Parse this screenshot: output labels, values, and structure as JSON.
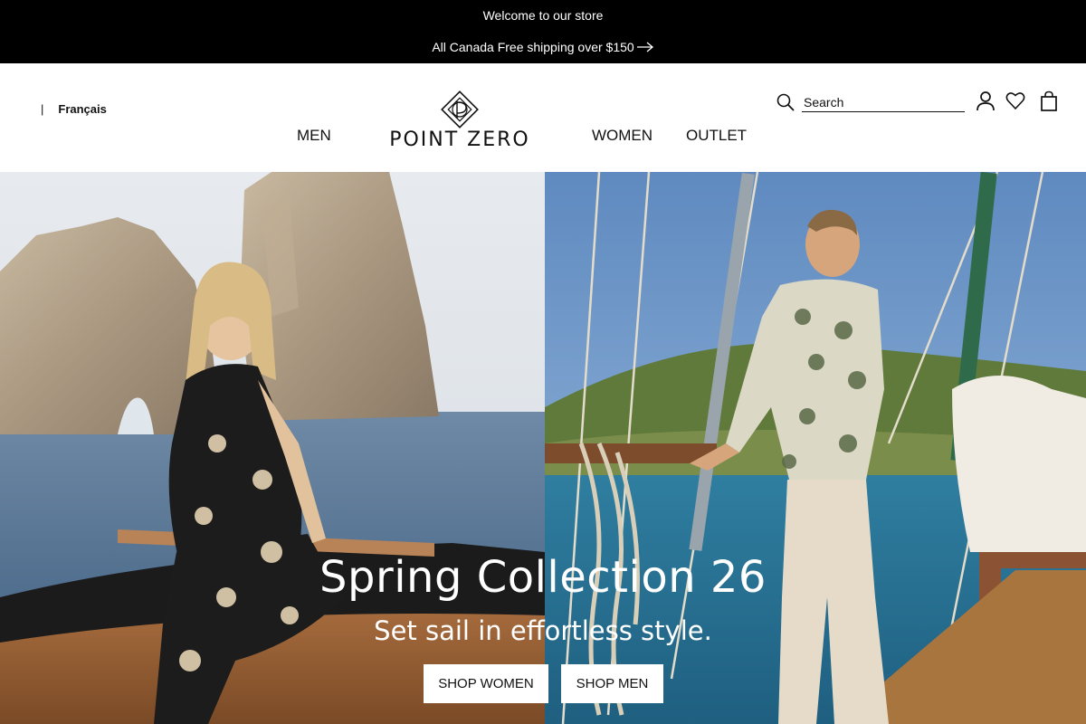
{
  "announcement": {
    "welcome": "Welcome to our store",
    "shipping": "All Canada Free shipping over $150",
    "arrow_icon": "arrow-right-icon"
  },
  "header": {
    "language_separator": "|",
    "language_link": "Français",
    "logo": "POINT ZERO",
    "nav": {
      "men": "MEN",
      "women": "WOMEN",
      "outlet": "OUTLET"
    },
    "search": {
      "placeholder": "Search",
      "icon": "search-icon"
    },
    "icons": {
      "account": "account-icon",
      "wishlist": "heart-icon",
      "cart": "bag-icon"
    }
  },
  "hero": {
    "title": "Spring Collection 26",
    "subtitle": "Set sail in effortless style.",
    "cta_women": "SHOP WOMEN",
    "cta_men": "SHOP MEN"
  },
  "colors": {
    "announcement_bg": "#000000",
    "announcement_text": "#ffffff",
    "cta_bg": "#ffffff",
    "text": "#111111"
  }
}
